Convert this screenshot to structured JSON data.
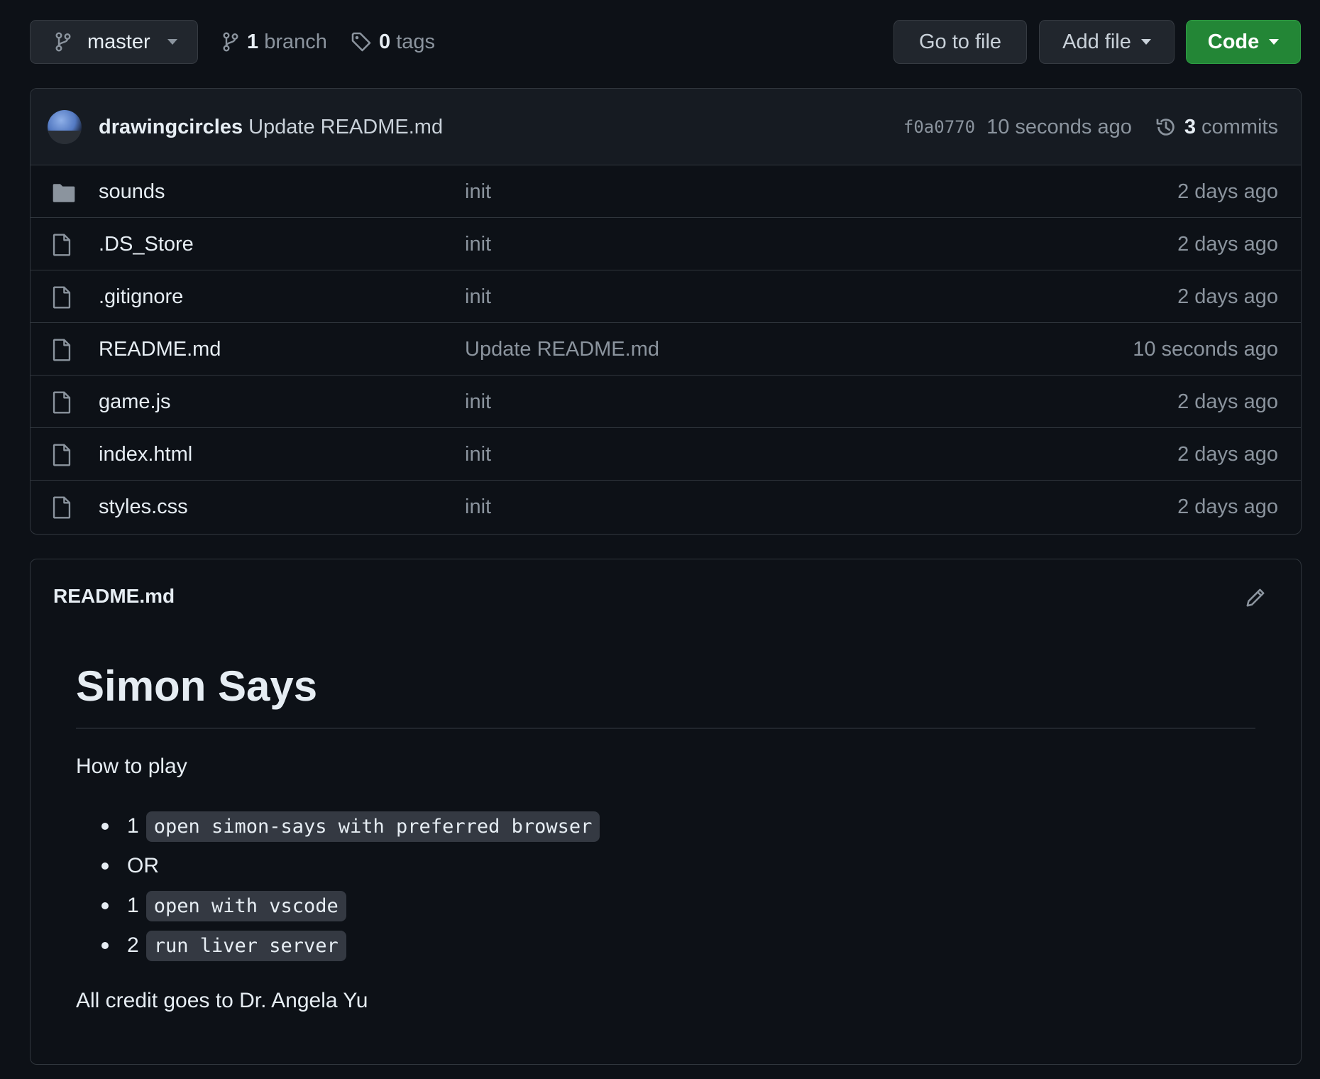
{
  "top": {
    "branch_button": "master",
    "branch_count": "1",
    "branch_word": "branch",
    "tag_count": "0",
    "tag_word": "tags",
    "go_to_file": "Go to file",
    "add_file": "Add file",
    "code": "Code",
    "code_color": "#238636"
  },
  "commit": {
    "author": "drawingcircles",
    "message": "Update README.md",
    "sha": "f0a0770",
    "time": "10 seconds ago",
    "commit_count": "3",
    "commit_word": "commits"
  },
  "files": [
    {
      "name": "sounds",
      "icon": "folder-icon",
      "message": "init",
      "date": "2 days ago"
    },
    {
      "name": ".DS_Store",
      "icon": "file-icon",
      "message": "init",
      "date": "2 days ago"
    },
    {
      "name": ".gitignore",
      "icon": "file-icon",
      "message": "init",
      "date": "2 days ago"
    },
    {
      "name": "README.md",
      "icon": "file-icon",
      "message": "Update README.md",
      "date": "10 seconds ago"
    },
    {
      "name": "game.js",
      "icon": "file-icon",
      "message": "init",
      "date": "2 days ago"
    },
    {
      "name": "index.html",
      "icon": "file-icon",
      "message": "init",
      "date": "2 days ago"
    },
    {
      "name": "styles.css",
      "icon": "file-icon",
      "message": "init",
      "date": "2 days ago"
    }
  ],
  "readme": {
    "filename": "README.md",
    "heading": "Simon Says",
    "intro": "How to play",
    "items": [
      {
        "number": "1",
        "code": "open simon-says with preferred browser"
      },
      {
        "text": "OR"
      },
      {
        "number": "1",
        "code": "open with vscode"
      },
      {
        "number": "2",
        "code": "run liver server"
      }
    ],
    "credit": "All credit goes to Dr. Angela Yu"
  }
}
